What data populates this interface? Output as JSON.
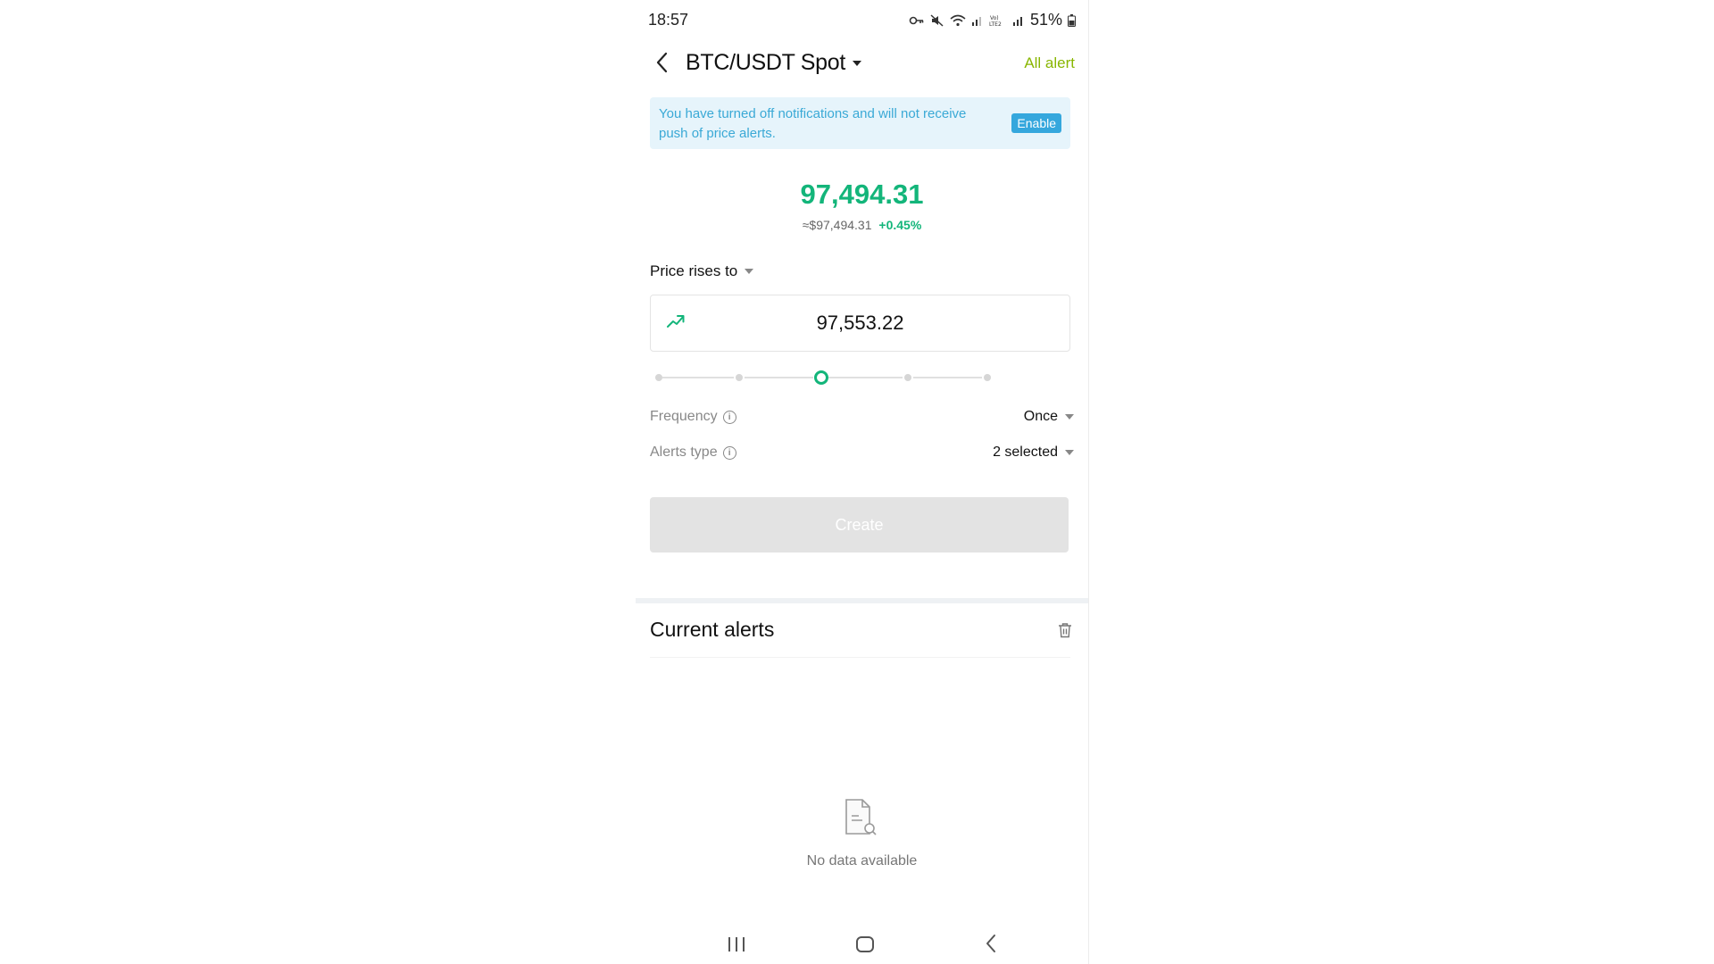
{
  "status_bar": {
    "time": "18:57",
    "battery": "51%"
  },
  "header": {
    "title": "BTC/USDT Spot",
    "all_alert_label": "All alert"
  },
  "banner": {
    "text": "You have turned off notifications and will not receive push of price alerts.",
    "enable_label": "Enable"
  },
  "price": {
    "main": "97,494.31",
    "approx": "≈$97,494.31",
    "change": "+0.45%"
  },
  "condition": {
    "label": "Price rises to"
  },
  "target_input": {
    "value": "97,553.22"
  },
  "slider": {
    "stops": 5,
    "selected_index": 2
  },
  "frequency": {
    "label": "Frequency",
    "value": "Once"
  },
  "alerts_type": {
    "label": "Alerts type",
    "value": "2 selected"
  },
  "create_label": "Create",
  "current_alerts": {
    "title": "Current alerts",
    "empty_text": "No data available"
  },
  "colors": {
    "green": "#13b57a",
    "accent_lime": "#88b600",
    "banner_bg": "#e6f4fb",
    "banner_text": "#3aa9d6",
    "enable_bg": "#35a7dd"
  }
}
